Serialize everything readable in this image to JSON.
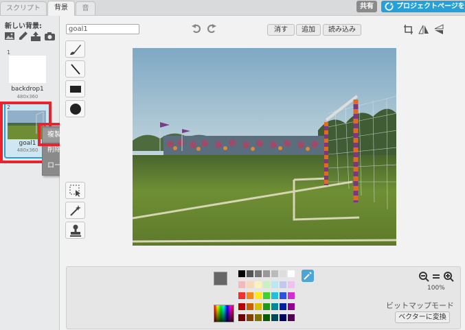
{
  "tabs": [
    {
      "label": "スクリプト"
    },
    {
      "label": "背景"
    },
    {
      "label": "音"
    }
  ],
  "header": {
    "share_label": "共有",
    "project_page_label": "プロジェクトページを見る"
  },
  "backdrops": {
    "new_label": "新しい背景:",
    "items": [
      {
        "index": "1",
        "name": "backdrop1",
        "size": "480x360"
      },
      {
        "index": "2",
        "name": "goal1",
        "size": "480x360"
      }
    ]
  },
  "context_menu": {
    "items": [
      {
        "label": "複製"
      },
      {
        "label": "削除"
      },
      {
        "label": "ローカルファイルに保存"
      }
    ]
  },
  "editor": {
    "costume_name": "goal1",
    "clear_label": "消す",
    "add_label": "追加",
    "import_label": "読み込み"
  },
  "palette": {
    "zoom": "100%",
    "mode_label": "ビットマップモード",
    "convert_label": "ベクターに変換",
    "colors": [
      [
        "#000000",
        "#555555",
        "#777777",
        "#999999",
        "#bbbbbb",
        "#dddddd",
        "#ffffff"
      ],
      [
        "#f4b8b8",
        "#f8d8b8",
        "#fbf2b8",
        "#c8f0c0",
        "#b8e8f0",
        "#c0c8f0",
        "#f0c0f0"
      ],
      [
        "#ee3030",
        "#f28a1a",
        "#ffe81a",
        "#40d030",
        "#20c0d8",
        "#3050e0",
        "#d030d0"
      ],
      [
        "#b80000",
        "#c86000",
        "#d8c000",
        "#1e9a18",
        "#008898",
        "#0020a0",
        "#900090"
      ],
      [
        "#700000",
        "#804000",
        "#807000",
        "#0a5a08",
        "#004858",
        "#000060",
        "#500050"
      ]
    ]
  }
}
